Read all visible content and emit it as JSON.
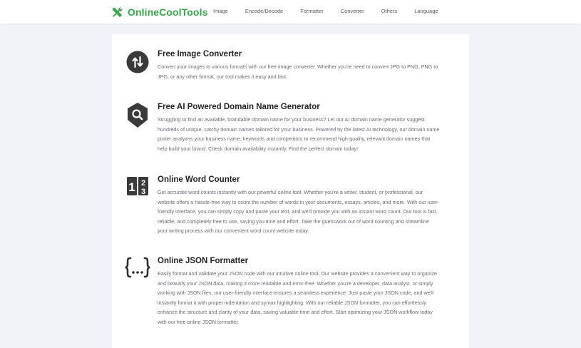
{
  "header": {
    "brand": "OnlineCoolTools",
    "brand_icon": "tools-icon",
    "brand_color": "#38a64a",
    "nav": [
      "Image",
      "Encode/Decode",
      "Formatter",
      "Converter",
      "Others",
      "Language"
    ]
  },
  "tools": [
    {
      "title": "Free Image Converter",
      "icon": "convert-arrows-icon",
      "description": "Convert your images to various formats with our free image converter. Whether you're need to convert JPG to PNG, PNG to JPG, or any other format, our tool makes it easy and fast."
    },
    {
      "title": "Free AI Powered Domain Name Generator",
      "icon": "search-badge-icon",
      "description": "Struggling to find an available, brandable domain name for your business? Let our AI domain name generator suggest hundreds of unique, catchy domain names tailored for your business. Powered by the latest AI technology, our domain name picker analyzes your business name, keywords and competitors to recommend high-quality, relevant domain names that help build your brand. Check domain availability instantly. Find the perfect domain today!"
    },
    {
      "title": "Online Word Counter",
      "icon": "number-counter-icon",
      "description": "Get accurate word counts instantly with our powerful online tool. Whether you're a writer, student, or professional, our website offers a hassle-free way to count the number of words in your documents, essays, articles, and more. With our user-friendly interface, you can simply copy and paste your text, and we'll provide you with an instant word count. Our tool is fast, reliable, and completely free to use, saving you time and effort. Take the guesswork out of word counting and streamline your writing process with our convenient word count website today."
    },
    {
      "title": "Online JSON Formatter",
      "icon": "curly-braces-icon",
      "description": "Easily format and validate your JSON code with our intuitive online tool. Our website provides a convenient way to organize and beautify your JSON data, making it more readable and error-free. Whether you're a developer, data analyst, or simply working with JSON files, our user-friendly interface ensures a seamless experience. Just paste your JSON code, and we'll instantly format it with proper indentation and syntax highlighting. With our reliable JSON formatter, you can effortlessly enhance the structure and clarity of your data, saving valuable time and effort. Start optimizing your JSON workflow today with our free online JSON formatter."
    }
  ]
}
